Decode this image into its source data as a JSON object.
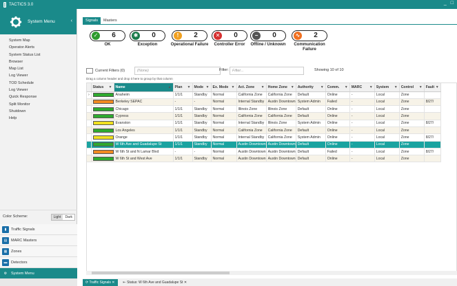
{
  "app": {
    "title": "TACTICS 3.0",
    "window_controls": "_ □"
  },
  "sidebar": {
    "header": "System Menu",
    "items": [
      "System Map",
      "Operator Alerts",
      "System Status List",
      "Browser",
      "Map List",
      "Log Viewer",
      "TOD Schedule",
      "Log Viewer",
      "Quick Response",
      "Split Monitor",
      "Shutdown",
      "Help"
    ],
    "color_scheme_label": "Color Scheme:",
    "scheme_light": "Light",
    "scheme_dark": "Dark",
    "nav": [
      {
        "label": "Traffic Signals",
        "icon": "traffic-signal-icon"
      },
      {
        "label": "MARC Masters",
        "icon": "marc-masters-icon"
      },
      {
        "label": "Zones",
        "icon": "zones-icon"
      },
      {
        "label": "Detectors",
        "icon": "detectors-icon"
      },
      {
        "label": "System Menu",
        "icon": "gear-icon"
      }
    ]
  },
  "tabs": [
    "Signals",
    "Masters"
  ],
  "summary": [
    {
      "count": "6",
      "label": "OK",
      "color": "#2e9a2e"
    },
    {
      "count": "0",
      "label": "Exception",
      "color": "#1a7a4a"
    },
    {
      "count": "2",
      "label": "Operational Failure",
      "color": "#f0a020"
    },
    {
      "count": "0",
      "label": "Controller Error",
      "color": "#d63030"
    },
    {
      "count": "0",
      "label": "Offline / Unknown",
      "color": "#555555"
    },
    {
      "count": "2",
      "label": "Communication Failure",
      "color": "#f07020"
    }
  ],
  "filters": {
    "current_label": "Current Filters (0)",
    "current_value": "(None)",
    "filter_label": "Filter:",
    "filter_placeholder": "Filter...",
    "showing": "Showing 10 of 10",
    "drag_hint": "Drag a column header and drop it here to group by that column"
  },
  "table": {
    "columns": [
      "Status",
      "Name",
      "Plan",
      "Mode",
      "Ex. Mode",
      "Act. Zone",
      "Home Zone",
      "Authority",
      "Comm.",
      "MARC",
      "System",
      "Control",
      "Fault"
    ],
    "rows": [
      {
        "status": "#2eaa2e",
        "name": "Anaheim",
        "plan": "1/1/1",
        "mode": "Standby",
        "exmode": "Normal",
        "act": "California Zone",
        "home": "California Zone",
        "auth": "Default",
        "comm": "Online",
        "marc": "-",
        "system": "Local",
        "control": "Zone",
        "fault": ""
      },
      {
        "status": "#f08a20",
        "name": "Berkeley SEPAC",
        "plan": "-",
        "mode": "-",
        "exmode": "Normal",
        "act": "Internal Standby",
        "home": "Austin Downtown",
        "auth": "System Admin",
        "comm": "Failed",
        "marc": "-",
        "system": "Local",
        "control": "Zone",
        "fault": "8/27/"
      },
      {
        "status": "#2eaa2e",
        "name": "Chicago",
        "plan": "1/1/1",
        "mode": "Standby",
        "exmode": "Normal",
        "act": "Illinois Zone",
        "home": "Illinois Zone",
        "auth": "Default",
        "comm": "Online",
        "marc": "-",
        "system": "Local",
        "control": "Zone",
        "fault": ""
      },
      {
        "status": "#2eaa2e",
        "name": "Cypress",
        "plan": "1/1/1",
        "mode": "Standby",
        "exmode": "Normal",
        "act": "California Zone",
        "home": "California Zone",
        "auth": "Default",
        "comm": "Online",
        "marc": "-",
        "system": "Local",
        "control": "Zone",
        "fault": ""
      },
      {
        "status": "#f0e020",
        "name": "Evanston",
        "plan": "1/1/1",
        "mode": "Standby",
        "exmode": "Normal",
        "act": "Internal Standby",
        "home": "Illinois Zone",
        "auth": "System Admin",
        "comm": "Online",
        "marc": "-",
        "system": "Local",
        "control": "Zone",
        "fault": "8/27/"
      },
      {
        "status": "#2eaa2e",
        "name": "Los Angeles",
        "plan": "1/1/1",
        "mode": "Standby",
        "exmode": "Normal",
        "act": "California Zone",
        "home": "California Zone",
        "auth": "Default",
        "comm": "Online",
        "marc": "-",
        "system": "Local",
        "control": "Zone",
        "fault": ""
      },
      {
        "status": "#f0e020",
        "name": "Orange",
        "plan": "1/1/1",
        "mode": "Standby",
        "exmode": "Normal",
        "act": "Internal Standby",
        "home": "California Zone",
        "auth": "System Admin",
        "comm": "Online",
        "marc": "-",
        "system": "Local",
        "control": "Zone",
        "fault": "8/27/"
      },
      {
        "status": "#2eaa2e",
        "name": "W 6th Ave and Guadalupe St",
        "plan": "1/1/1",
        "mode": "Standby",
        "exmode": "Normal",
        "act": "Austin Downtown",
        "home": "Austin Downtown",
        "auth": "Default",
        "comm": "Online",
        "marc": "-",
        "system": "Local",
        "control": "Zone",
        "fault": ""
      },
      {
        "status": "#f08a20",
        "name": "W 6th St and N Lamar Blvd",
        "plan": "-",
        "mode": "-",
        "exmode": "Normal",
        "act": "Austin Downtown",
        "home": "Austin Downtown",
        "auth": "Default",
        "comm": "Failed",
        "marc": "-",
        "system": "Local",
        "control": "Zone",
        "fault": "8/27/"
      },
      {
        "status": "#2eaa2e",
        "name": "W 6th St and West Ave",
        "plan": "1/1/1",
        "mode": "Standby",
        "exmode": "Normal",
        "act": "Austin Downtown",
        "home": "Austin Downtown",
        "auth": "Default",
        "comm": "Online",
        "marc": "-",
        "system": "Local",
        "control": "Zone",
        "fault": ""
      }
    ],
    "selected_index": 7
  },
  "statusbar": {
    "tab1": "Traffic Signals",
    "tab2": "Status: W 6th Ave and Guadalupe St"
  }
}
